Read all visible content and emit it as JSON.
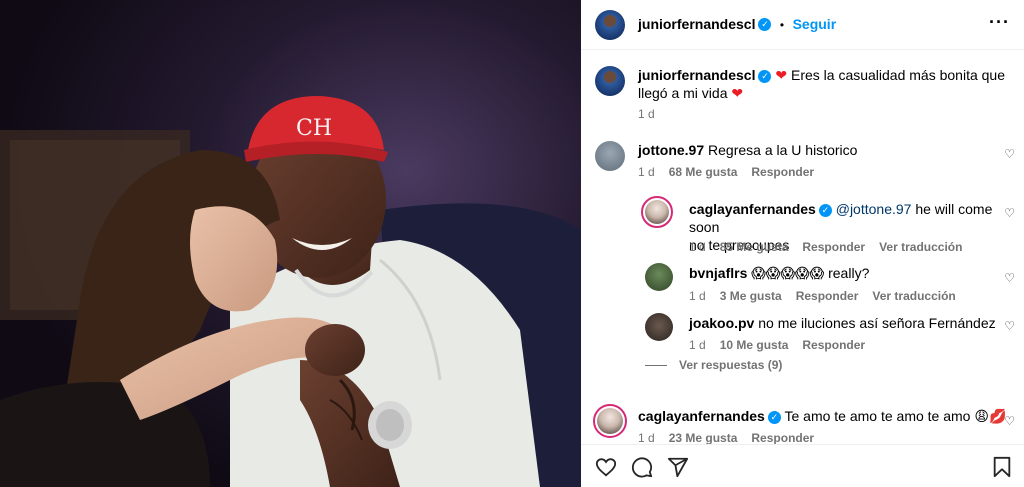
{
  "post": {
    "author": "juniorfernandescl",
    "follow_label": "Seguir",
    "separator": "•",
    "more_icon": "more-icon"
  },
  "caption": {
    "author": "juniorfernandescl",
    "text": "Eres la casualidad más bonita que llegó a mi vida",
    "time": "1 d"
  },
  "comments": [
    {
      "user": "jottone.97",
      "text": "Regresa a la U historico",
      "time": "1 d",
      "likes": "68 Me gusta",
      "reply": "Responder"
    },
    {
      "user": "caglayanfernandes",
      "verified": true,
      "mention": "@jottone.97",
      "text": "he will come soon no te preocupes",
      "text_line1": "he will come soon",
      "text_line2": "no te preocupes",
      "time": "1 d",
      "likes": "85 Me gusta",
      "reply": "Responder",
      "translate": "Ver traducción"
    },
    {
      "user": "bvnjaflrs",
      "text": "😱😱😱😱😱 really?",
      "time": "1 d",
      "likes": "3 Me gusta",
      "reply": "Responder",
      "translate": "Ver traducción"
    },
    {
      "user": "joakoo.pv",
      "text": "no me iluciones así señora Fernández",
      "time": "1 d",
      "likes": "10 Me gusta",
      "reply": "Responder"
    },
    {
      "user": "caglayanfernandes",
      "verified": true,
      "text": "Te amo te amo te amo te amo 😩💋",
      "time": "1 d",
      "likes": "23 Me gusta",
      "reply": "Responder"
    }
  ],
  "view_replies": "Ver respuestas (9)",
  "actions": {
    "like_icon": "heart-icon",
    "comment_icon": "comment-icon",
    "share_icon": "share-icon",
    "save_icon": "bookmark-icon"
  },
  "colors": {
    "accent": "#0095f6",
    "heart": "#ed1c24",
    "muted": "#737373"
  }
}
